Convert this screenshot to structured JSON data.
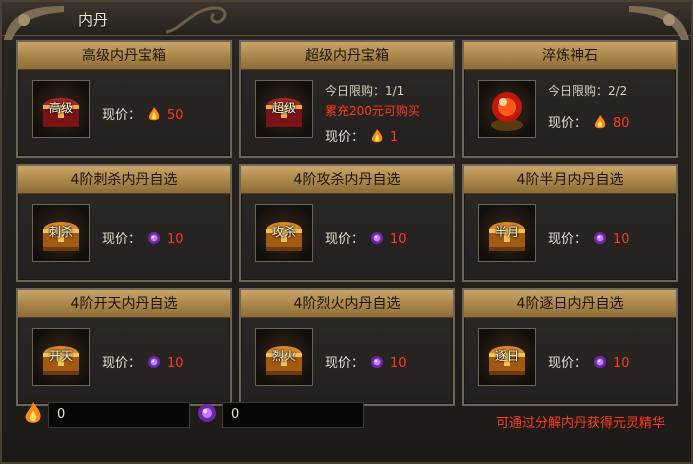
{
  "window": {
    "title": "内丹"
  },
  "price_label": "现价：",
  "cards": [
    {
      "title": "高级内丹宝箱",
      "thumb_label": "高级",
      "currency": "fire",
      "price": "50"
    },
    {
      "title": "超级内丹宝箱",
      "thumb_label": "超级",
      "limit": "今日限购：1/1",
      "notice": "累充200元可购买",
      "currency": "fire",
      "price": "1"
    },
    {
      "title": "淬炼神石",
      "thumb_label": "",
      "limit": "今日限购：2/2",
      "currency": "fire",
      "price": "80"
    },
    {
      "title": "4阶刺杀内丹自选",
      "thumb_label": "刺杀",
      "currency": "soul",
      "price": "10"
    },
    {
      "title": "4阶攻杀内丹自选",
      "thumb_label": "攻杀",
      "currency": "soul",
      "price": "10"
    },
    {
      "title": "4阶半月内丹自选",
      "thumb_label": "半月",
      "currency": "soul",
      "price": "10"
    },
    {
      "title": "4阶开天内丹自选",
      "thumb_label": "开天",
      "currency": "soul",
      "price": "10"
    },
    {
      "title": "4阶烈火内丹自选",
      "thumb_label": "烈火",
      "currency": "soul",
      "price": "10"
    },
    {
      "title": "4阶逐日内丹自选",
      "thumb_label": "逐日",
      "currency": "soul",
      "price": "10"
    }
  ],
  "footer": {
    "fire_amount": "0",
    "soul_amount": "0",
    "hint": "可通过分解内丹获得元灵精华"
  },
  "colors": {
    "price_red": "#ff3a1a",
    "header_gold": "#b8914f"
  },
  "icons": {
    "fire": "fire-essence-icon",
    "soul": "soul-orb-icon",
    "chest": "treasure-chest-icon",
    "stone": "refining-stone-icon"
  }
}
